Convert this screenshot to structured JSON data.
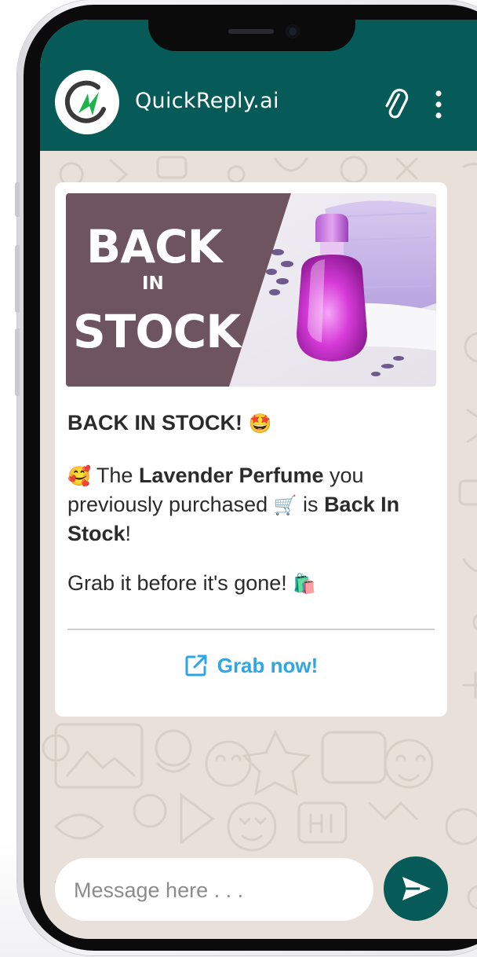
{
  "header": {
    "title": "QuickReply.ai",
    "avatar_icon": "quickreply-logo-icon",
    "attach_icon": "paperclip-icon",
    "menu_icon": "more-vertical-icon"
  },
  "banner": {
    "line1": "BACK",
    "line2": "IN",
    "line3": "STOCK",
    "product_image": "lavender-perfume-bottle"
  },
  "message": {
    "title": "BACK IN STOCK!",
    "title_emoji": "🤩",
    "para_emoji": "🥰",
    "para_t1": " The ",
    "para_product": "Lavender Perfume",
    "para_t2": " you previously purchased ",
    "cart_emoji": "🛒",
    "para_t3": " is ",
    "para_status": "Back In Stock",
    "para_t4": "!",
    "grab_text": "Grab it before it's gone! ",
    "bag_emoji": "🛍️"
  },
  "cta": {
    "label": "Grab now!",
    "icon": "external-link-icon"
  },
  "composer": {
    "placeholder": "Message here . . .",
    "value": "",
    "send_icon": "send-icon"
  },
  "colors": {
    "header": "#065b58",
    "accent_link": "#2ea6e6",
    "chat_background": "#e9e1d9",
    "banner_panel": "#6e545f"
  }
}
